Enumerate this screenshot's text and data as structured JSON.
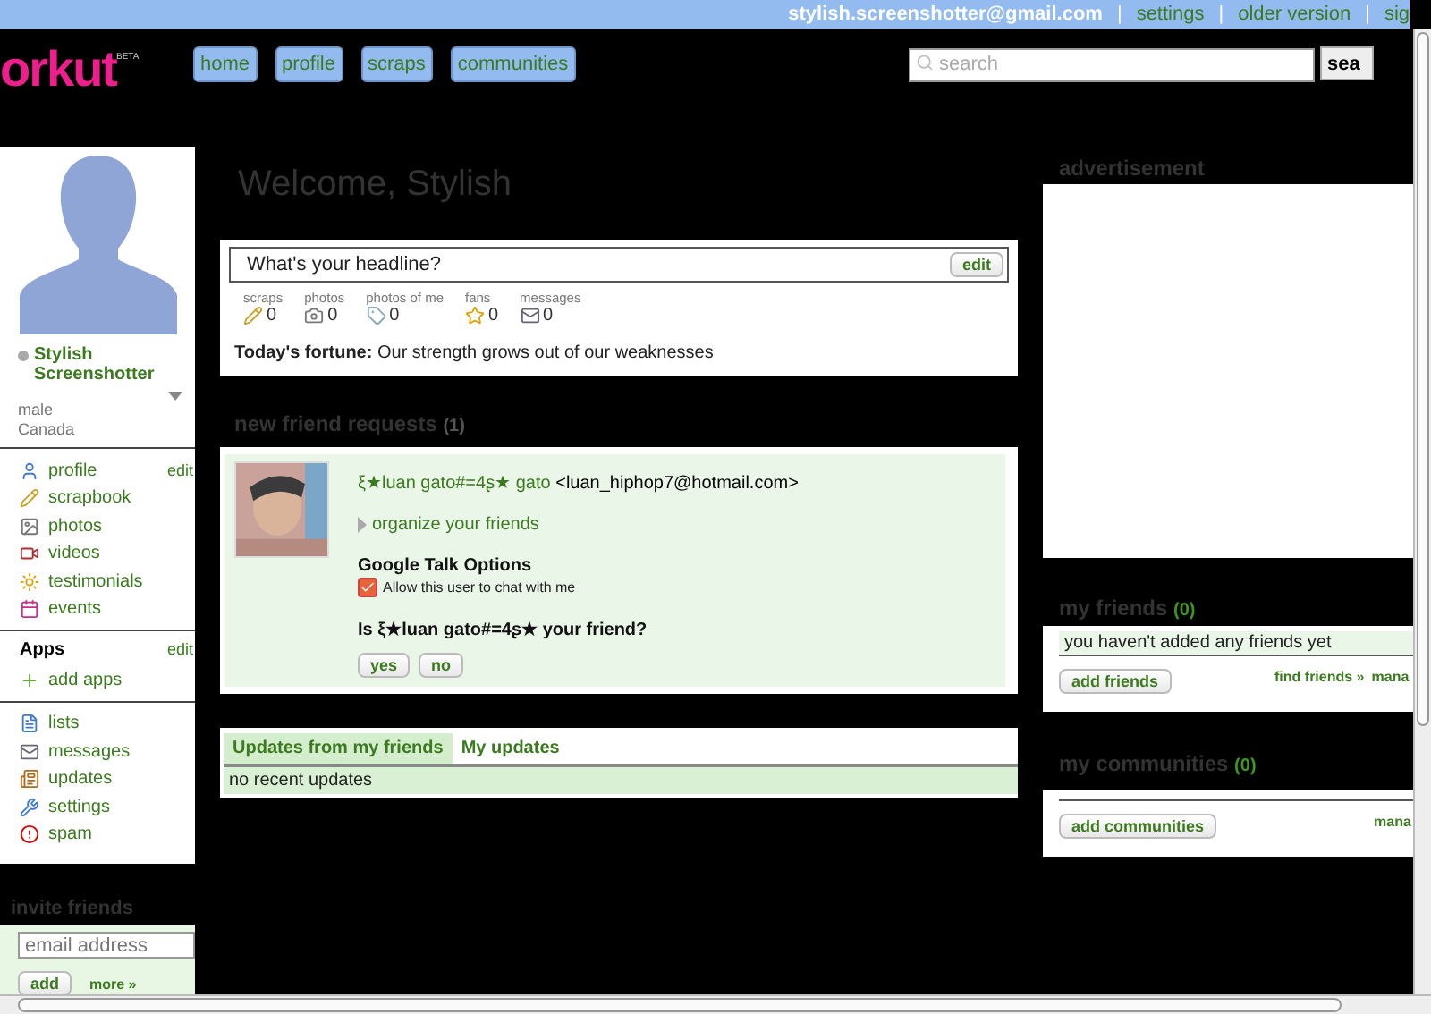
{
  "top_bar": {
    "email": "stylish.screenshotter@gmail.com",
    "links": [
      {
        "separator": "|",
        "label": "settings"
      },
      {
        "separator": "|",
        "label": "older version"
      },
      {
        "separator": "|",
        "label": "sig"
      }
    ]
  },
  "logo": {
    "name": "orkut",
    "badge": "BETA"
  },
  "nav": [
    "home",
    "profile",
    "scraps",
    "communities"
  ],
  "search": {
    "placeholder": "search",
    "button": "sea"
  },
  "profile": {
    "name": "Stylish Screenshotter",
    "gender": "male",
    "country": "Canada"
  },
  "sidebar": {
    "items": [
      {
        "label": "profile",
        "edit": "edit"
      },
      {
        "label": "scrapbook"
      },
      {
        "label": "photos"
      },
      {
        "label": "videos"
      },
      {
        "label": "testimonials"
      },
      {
        "label": "events"
      }
    ],
    "apps_title": "Apps",
    "apps_edit": "edit",
    "apps": [
      {
        "label": "add apps"
      }
    ],
    "more": [
      {
        "label": "lists"
      },
      {
        "label": "messages"
      },
      {
        "label": "updates"
      },
      {
        "label": "settings"
      },
      {
        "label": "spam"
      }
    ]
  },
  "invite": {
    "title": "invite friends",
    "placeholder": "email address",
    "button": "add",
    "link": "more »"
  },
  "welcome": "Welcome, Stylish",
  "headline": {
    "placeholder": "What's your headline?",
    "button": "edit"
  },
  "stats": [
    {
      "label": "scraps",
      "value": "0"
    },
    {
      "label": "photos",
      "value": "0"
    },
    {
      "label": "photos of me",
      "value": "0"
    },
    {
      "label": "fans",
      "value": "0"
    },
    {
      "label": "messages",
      "value": "0"
    }
  ],
  "fortune": "**Today's fortune:** Our strength grows out of our weaknesses",
  "friend_requests": {
    "title": "new friend requests",
    "count": "(1)",
    "name": "ξ★luan gato#=4ʂ★ gato",
    "email": "<luan_hiphop7@hotmail.com>",
    "organize": "organize your friends",
    "talk_title": "Google Talk Options",
    "talk_option": {
      "label": "Allow this user to chat with me",
      "checked": true
    },
    "question": "Is ξ★luan gato#=4ʂ★ your friend?",
    "buttons": [
      "yes",
      "no"
    ]
  },
  "updates": {
    "tabs": [
      {
        "label": "Updates from my friends",
        "selected": true
      },
      {
        "label": "My updates",
        "selected": false
      }
    ],
    "empty": "no recent updates"
  },
  "advertisement": {
    "title": "advertisement"
  },
  "my_friends": {
    "title": "my friends",
    "count": "(0)",
    "empty": "you haven't added any friends yet",
    "button": "add friends",
    "links": [
      "find friends »",
      "mana"
    ]
  },
  "my_communities": {
    "title": "my communities",
    "count": "(0)",
    "button": "add communities",
    "links": [
      "mana"
    ]
  }
}
